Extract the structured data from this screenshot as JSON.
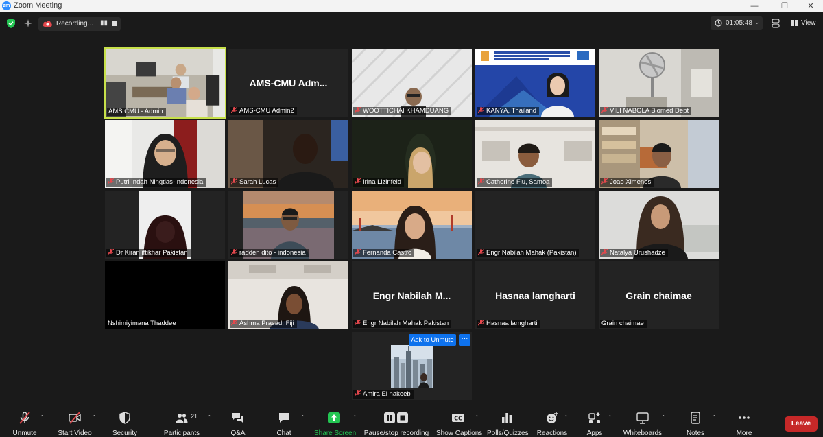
{
  "window": {
    "title": "Zoom Meeting",
    "logo_text": "zm"
  },
  "topbar": {
    "recording_label": "Recording...",
    "timer": "01:05:48",
    "view_label": "View"
  },
  "participants": [
    {
      "name": "AMS CMU - Admin",
      "muted": false,
      "placeholder": ""
    },
    {
      "name": "AMS-CMU Admin2",
      "muted": true,
      "placeholder": "AMS-CMU  Adm..."
    },
    {
      "name": "WOOTTICHAI KHAMDUANG",
      "muted": true,
      "placeholder": ""
    },
    {
      "name": "KANYA, Thailand",
      "muted": true,
      "placeholder": ""
    },
    {
      "name": "VILI NABOLA Biomed Dept",
      "muted": true,
      "placeholder": ""
    },
    {
      "name": "Putri Indah Ningtias-Indonesia",
      "muted": true,
      "placeholder": ""
    },
    {
      "name": "Sarah Lucas",
      "muted": true,
      "placeholder": ""
    },
    {
      "name": "Irina Lizinfeld",
      "muted": true,
      "placeholder": ""
    },
    {
      "name": "Catherine Fiu, Samoa",
      "muted": true,
      "placeholder": ""
    },
    {
      "name": "Joao Ximenes",
      "muted": true,
      "placeholder": ""
    },
    {
      "name": "Dr Kiran iftikhar Pakistan",
      "muted": true,
      "placeholder": ""
    },
    {
      "name": "radden dito - indonesia",
      "muted": true,
      "placeholder": ""
    },
    {
      "name": "Fernanda Castro",
      "muted": true,
      "placeholder": ""
    },
    {
      "name": "Engr Nabilah Mahak (Pakistan)",
      "muted": true,
      "placeholder": ""
    },
    {
      "name": "Natalya Urushadze",
      "muted": true,
      "placeholder": ""
    },
    {
      "name": "Nshimiyimana Thaddee",
      "muted": false,
      "placeholder": ""
    },
    {
      "name": "Ashma Prasad, Fiji",
      "muted": true,
      "placeholder": ""
    },
    {
      "name": "Engr Nabilah Mahak Pakistan",
      "muted": true,
      "placeholder": "Engr  Nabilah  M..."
    },
    {
      "name": "Hasnaa lamgharti",
      "muted": true,
      "placeholder": "Hasnaa lamgharti"
    },
    {
      "name": "Grain chaimae",
      "muted": false,
      "placeholder": "Grain chaimae"
    },
    {
      "name": "Amira El nakeeb",
      "muted": true,
      "placeholder": ""
    }
  ],
  "popover": {
    "ask_unmute": "Ask to Unmute",
    "more": "···"
  },
  "toolbar": {
    "unmute": "Unmute",
    "start_video": "Start Video",
    "security": "Security",
    "participants": "Participants",
    "participants_count": "21",
    "qa": "Q&A",
    "chat": "Chat",
    "share_screen": "Share Screen",
    "pause_stop_recording": "Pause/stop recording",
    "show_captions": "Show Captions",
    "polls": "Polls/Quizzes",
    "reactions": "Reactions",
    "apps": "Apps",
    "whiteboards": "Whiteboards",
    "notes": "Notes",
    "more": "More",
    "leave": "Leave"
  },
  "colors": {
    "accent": "#0e72ed",
    "share_green": "#23c552",
    "leave_red": "#c62828",
    "active_speaker": "#c7e04a",
    "muted_red": "#e5484d"
  }
}
